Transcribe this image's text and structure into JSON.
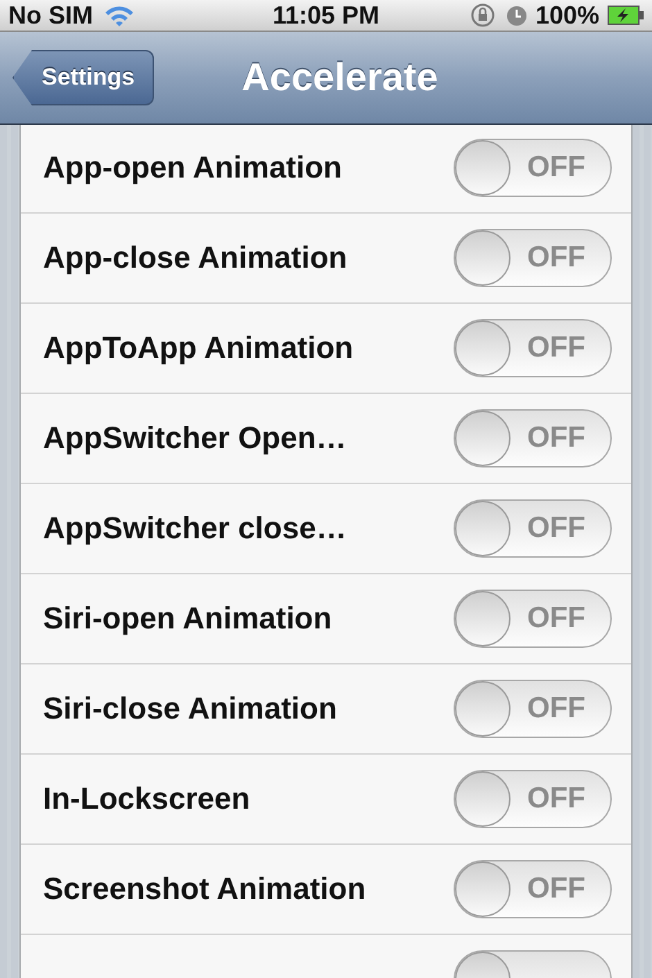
{
  "status_bar": {
    "carrier": "No SIM",
    "time": "11:05 PM",
    "battery": "100%"
  },
  "nav_bar": {
    "back": "Settings",
    "title": "Accelerate"
  },
  "rows": [
    {
      "label": "App-open Animation",
      "on": false,
      "switch_text": "OFF"
    },
    {
      "label": "App-close Animation",
      "on": false,
      "switch_text": "OFF"
    },
    {
      "label": "AppToApp Animation",
      "on": false,
      "switch_text": "OFF"
    },
    {
      "label": "AppSwitcher Open…",
      "on": false,
      "switch_text": "OFF"
    },
    {
      "label": "AppSwitcher close…",
      "on": false,
      "switch_text": "OFF"
    },
    {
      "label": "Siri-open Animation",
      "on": false,
      "switch_text": "OFF"
    },
    {
      "label": "Siri-close Animation",
      "on": false,
      "switch_text": "OFF"
    },
    {
      "label": "In-Lockscreen",
      "on": false,
      "switch_text": "OFF"
    },
    {
      "label": "Screenshot Animation",
      "on": false,
      "switch_text": "OFF"
    },
    {
      "on": false
    }
  ]
}
